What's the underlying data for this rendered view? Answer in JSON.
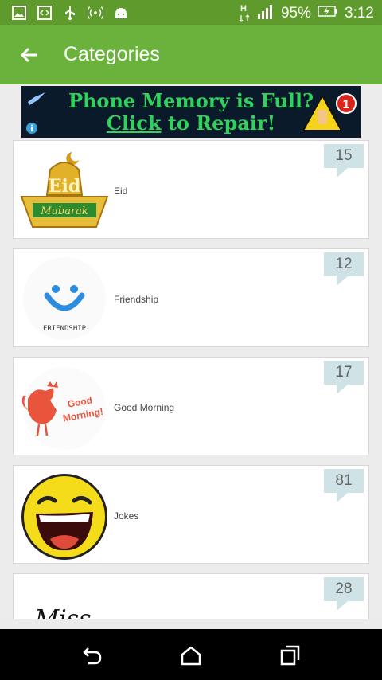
{
  "status_bar": {
    "left_icons": [
      "image-icon",
      "code-icon",
      "usb-icon",
      "hotspot-icon",
      "android-icon"
    ],
    "network_label": "H",
    "battery_percent": "95%",
    "time": "3:12"
  },
  "app_bar": {
    "back_icon": "arrow-left-icon",
    "title": "Categories"
  },
  "ad": {
    "line1": "Phone Memory is Full?",
    "line2_link": "Click",
    "line2_rest": " to Repair!",
    "badge_number": "1",
    "accent_color": "#2fd35c"
  },
  "categories": [
    {
      "name": "Eid",
      "count": "15",
      "thumb_text": "Mubarak",
      "thumb_icon": "eid-mubarak-lantern-icon"
    },
    {
      "name": "Friendship",
      "count": "12",
      "thumb_text": "FRIENDSHIP",
      "thumb_icon": "smiley-face-icon"
    },
    {
      "name": "Good Morning",
      "count": "17",
      "thumb_text": "Good Morning!",
      "thumb_icon": "rooster-icon"
    },
    {
      "name": "Jokes",
      "count": "81",
      "thumb_text": "",
      "thumb_icon": "laughing-face-icon"
    },
    {
      "name": "",
      "count": "28",
      "thumb_text": "Miss",
      "thumb_icon": "miss-you-script-icon"
    }
  ],
  "nav_bar": {
    "buttons": [
      "back-nav-icon",
      "home-nav-icon",
      "recents-nav-icon"
    ]
  },
  "colors": {
    "status_bar": "#5e9a2c",
    "app_bar": "#6ab23c",
    "badge": "#cfe3e6"
  }
}
